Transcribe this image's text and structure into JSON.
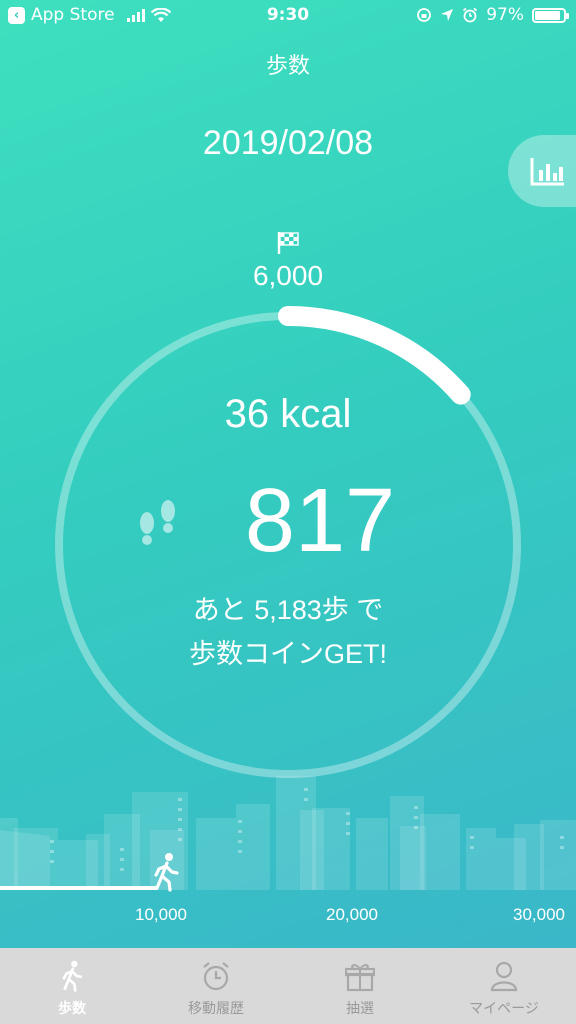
{
  "status_bar": {
    "back_app": "App Store",
    "time": "9:30",
    "battery": "97%",
    "battery_level": 0.97
  },
  "header": {
    "title": "歩数"
  },
  "date": "2019/02/08",
  "goal": {
    "label": "6,000",
    "value": 6000
  },
  "progress": {
    "steps_value": 817,
    "fraction": 0.136
  },
  "stats": {
    "kcal": "36 kcal",
    "steps": "817"
  },
  "message": {
    "line1": "あと 5,183歩 で",
    "line2": "歩数コインGET!"
  },
  "milestones": [
    "10,000",
    "20,000",
    "30,000"
  ],
  "tabs": [
    {
      "label": "歩数",
      "icon": "walk-icon",
      "active": true
    },
    {
      "label": "移動履歴",
      "icon": "clock-icon",
      "active": false
    },
    {
      "label": "抽選",
      "icon": "gift-box-icon",
      "active": false
    },
    {
      "label": "マイページ",
      "icon": "person-icon",
      "active": false
    }
  ],
  "colors": {
    "accent": "#34cdbf",
    "tab_bg": "#d9d9d9",
    "tab_inactive": "#9a9a9a"
  }
}
